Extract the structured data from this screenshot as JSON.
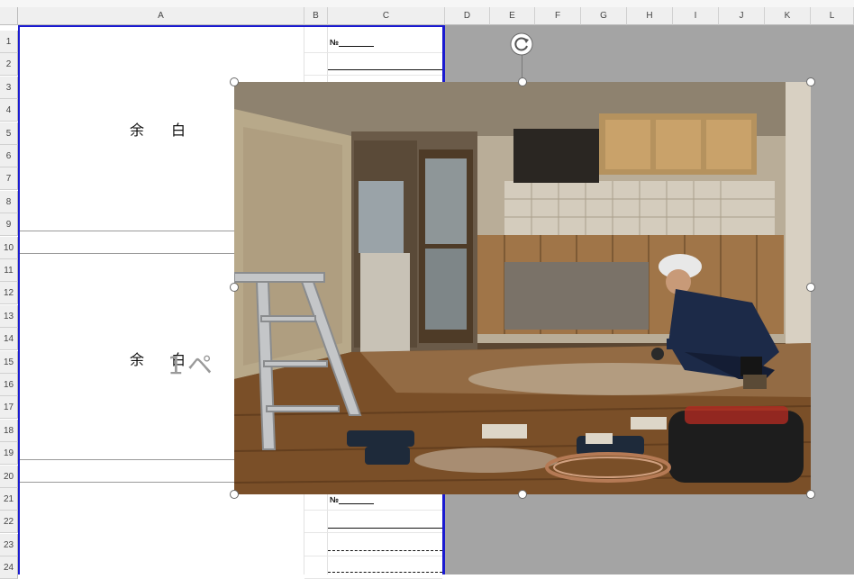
{
  "spreadsheet": {
    "columns": [
      "A",
      "B",
      "C",
      "D",
      "E",
      "F",
      "G",
      "H",
      "I",
      "J",
      "K",
      "L"
    ],
    "rows": [
      "1",
      "2",
      "3",
      "4",
      "5",
      "6",
      "7",
      "8",
      "9",
      "10",
      "11",
      "12",
      "13",
      "14",
      "15",
      "16",
      "17",
      "18",
      "19",
      "20",
      "21",
      "22",
      "23",
      "24"
    ]
  },
  "cells": {
    "yohaku_top": "余白",
    "yohaku_mid": "余白",
    "no_label_top": "№",
    "no_label_bottom": "№"
  },
  "watermark": {
    "page_text": "1ペ"
  },
  "picture": {
    "subject": "renovation-worker-kitchen-photo"
  },
  "colors": {
    "header_bg": "#efefef",
    "print_border": "#1a1ad0",
    "outside_print_area": "#a4a4a4"
  }
}
